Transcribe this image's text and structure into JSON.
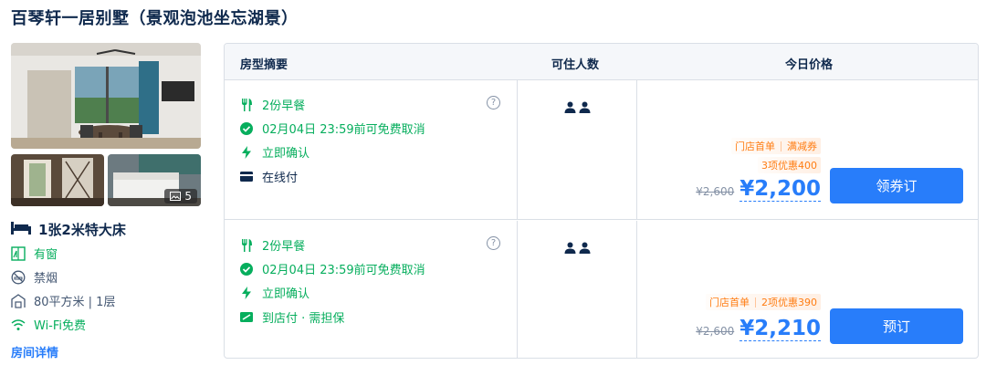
{
  "room": {
    "title": "百琴轩一居别墅（景观泡池坐忘湖景）",
    "photo_count": "5",
    "bed": "1张2米特大床",
    "features": [
      "有窗",
      "禁烟",
      "80平方米 | 1层",
      "Wi-Fi免费"
    ],
    "detail_link": "房间详情"
  },
  "table": {
    "headers": {
      "summary": "房型摘要",
      "occupancy": "可住人数",
      "price": "今日价格"
    },
    "rows": [
      {
        "perks": [
          "2份早餐",
          "02月04日 23:59前可免费取消",
          "立即确认",
          "在线付"
        ],
        "help": "?",
        "guests": 2,
        "tag_top": [
          "门店首单",
          "满减券"
        ],
        "tag_bottom": "3项优惠400",
        "original_price": "¥2,600",
        "price": "¥2,200",
        "button": "领券订"
      },
      {
        "perks": [
          "2份早餐",
          "02月04日 23:59前可免费取消",
          "立即确认",
          "到店付 · 需担保"
        ],
        "help": "?",
        "guests": 2,
        "tag_top": [
          "门店首单",
          "2项优惠390"
        ],
        "original_price": "¥2,600",
        "price": "¥2,210",
        "button": "预订"
      }
    ]
  },
  "colors": {
    "accent": "#287dfa",
    "green": "#06ae5d",
    "promo": "#ff7d13",
    "text": "#0f294d"
  },
  "icons": [
    "image-icon",
    "bed-icon",
    "window-icon",
    "no-smoking-icon",
    "floor-area-icon",
    "wifi-icon",
    "fork-knife-icon",
    "check-circle-icon",
    "lightning-icon",
    "card-icon",
    "pay-at-hotel-icon",
    "help-icon",
    "person-icon"
  ]
}
